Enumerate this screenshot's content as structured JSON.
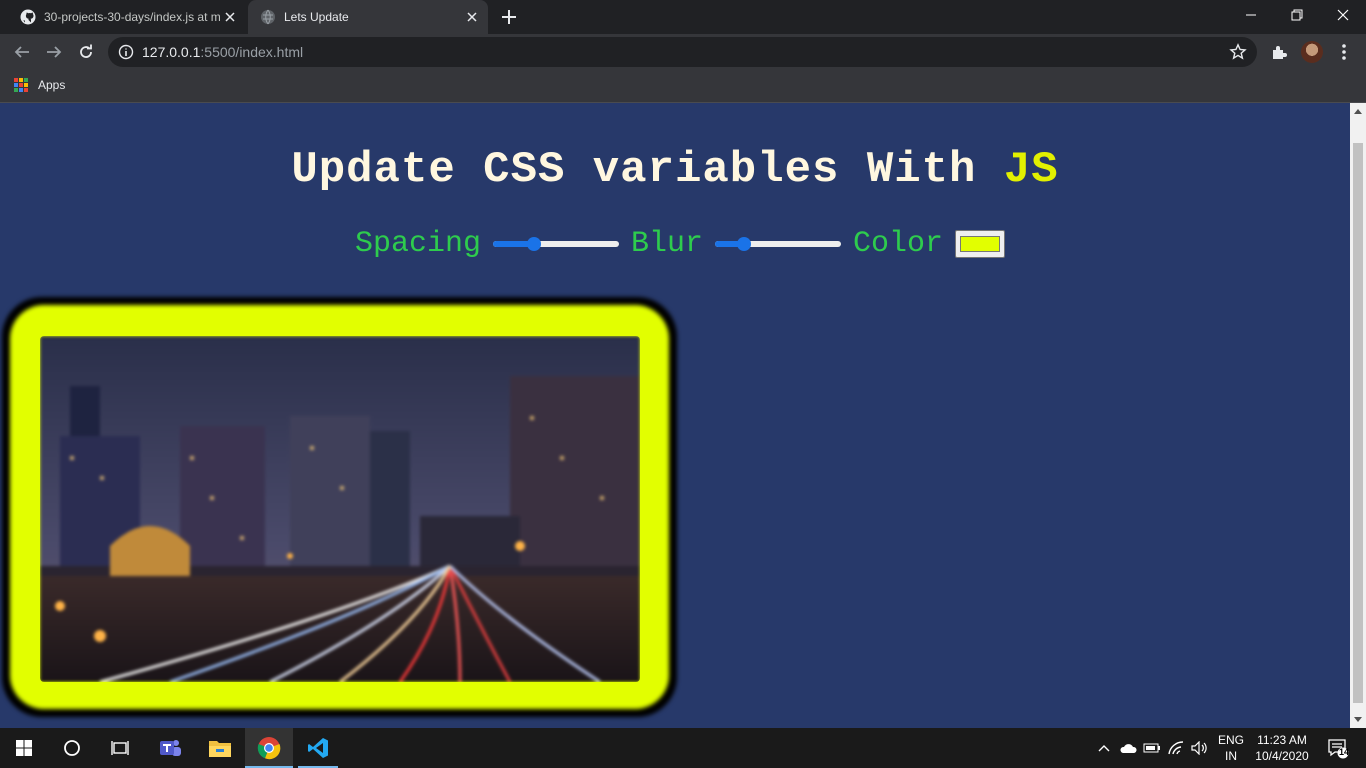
{
  "browser": {
    "tabs": [
      {
        "title": "30-projects-30-days/index.js at m",
        "active": false,
        "icon": "github-icon"
      },
      {
        "title": "Lets Update",
        "active": true,
        "icon": "globe-icon"
      }
    ],
    "url_host": "127.0.0.1",
    "url_rest": ":5500/index.html",
    "bookmarks": [
      {
        "label": "Apps",
        "icon": "apps-grid-icon"
      }
    ]
  },
  "page": {
    "title_main": "Update CSS variables With ",
    "title_highlight": "JS",
    "controls": {
      "spacing_label": "Spacing",
      "spacing_value": 0.3,
      "blur_label": "Blur",
      "blur_value": 0.2,
      "color_label": "Color",
      "color_value": "#e2ff00"
    },
    "image": {
      "subject": "city-night-light-trails",
      "border_color": "#e2ff00"
    }
  },
  "colors": {
    "page_bg": "#27396a",
    "title": "#fff7e0",
    "highlight": "#e2f000",
    "label": "#2ecc4d",
    "accent": "#1a73e8"
  },
  "taskbar": {
    "apps": [
      "windows-start-icon",
      "search-circle-icon",
      "task-view-icon",
      "teams-icon",
      "file-explorer-icon",
      "chrome-icon",
      "vscode-icon"
    ],
    "language_top": "ENG",
    "language_bottom": "IN",
    "time": "11:23 AM",
    "date": "10/4/2020",
    "notification_count": "14"
  }
}
